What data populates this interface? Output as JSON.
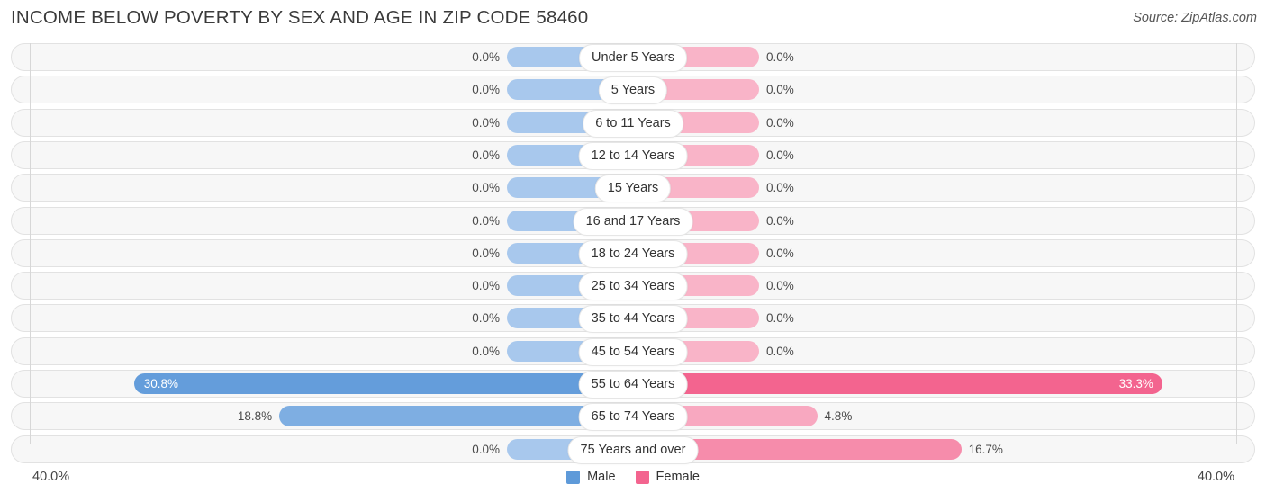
{
  "header": {
    "title": "Income Below Poverty by Sex and Age in Zip Code 58460",
    "source": "Source: ZipAtlas.com"
  },
  "legend": {
    "male_label": "Male",
    "female_label": "Female",
    "male_color": "#5e9ad9",
    "female_color": "#f3648f"
  },
  "axis": {
    "left_label": "40.0%",
    "right_label": "40.0%"
  },
  "chart_data": {
    "type": "bar",
    "orientation": "diverging-horizontal",
    "title": "Income Below Poverty by Sex and Age in Zip Code 58460",
    "xlabel": "",
    "ylabel": "",
    "xlim": [
      40.0,
      40.0
    ],
    "grid": true,
    "legend_position": "bottom-center",
    "categories": [
      "Under 5 Years",
      "5 Years",
      "6 to 11 Years",
      "12 to 14 Years",
      "15 Years",
      "16 and 17 Years",
      "18 to 24 Years",
      "25 to 34 Years",
      "35 to 44 Years",
      "45 to 54 Years",
      "55 to 64 Years",
      "65 to 74 Years",
      "75 Years and over"
    ],
    "series": [
      {
        "name": "Male",
        "values": [
          0.0,
          0.0,
          0.0,
          0.0,
          0.0,
          0.0,
          0.0,
          0.0,
          0.0,
          0.0,
          30.8,
          18.8,
          0.0
        ],
        "labels": [
          "0.0%",
          "0.0%",
          "0.0%",
          "0.0%",
          "0.0%",
          "0.0%",
          "0.0%",
          "0.0%",
          "0.0%",
          "0.0%",
          "30.8%",
          "18.8%",
          "0.0%"
        ]
      },
      {
        "name": "Female",
        "values": [
          0.0,
          0.0,
          0.0,
          0.0,
          0.0,
          0.0,
          0.0,
          0.0,
          0.0,
          0.0,
          33.3,
          4.8,
          16.7
        ],
        "labels": [
          "0.0%",
          "0.0%",
          "0.0%",
          "0.0%",
          "0.0%",
          "0.0%",
          "0.0%",
          "0.0%",
          "0.0%",
          "0.0%",
          "33.3%",
          "4.8%",
          "16.7%"
        ]
      }
    ]
  }
}
